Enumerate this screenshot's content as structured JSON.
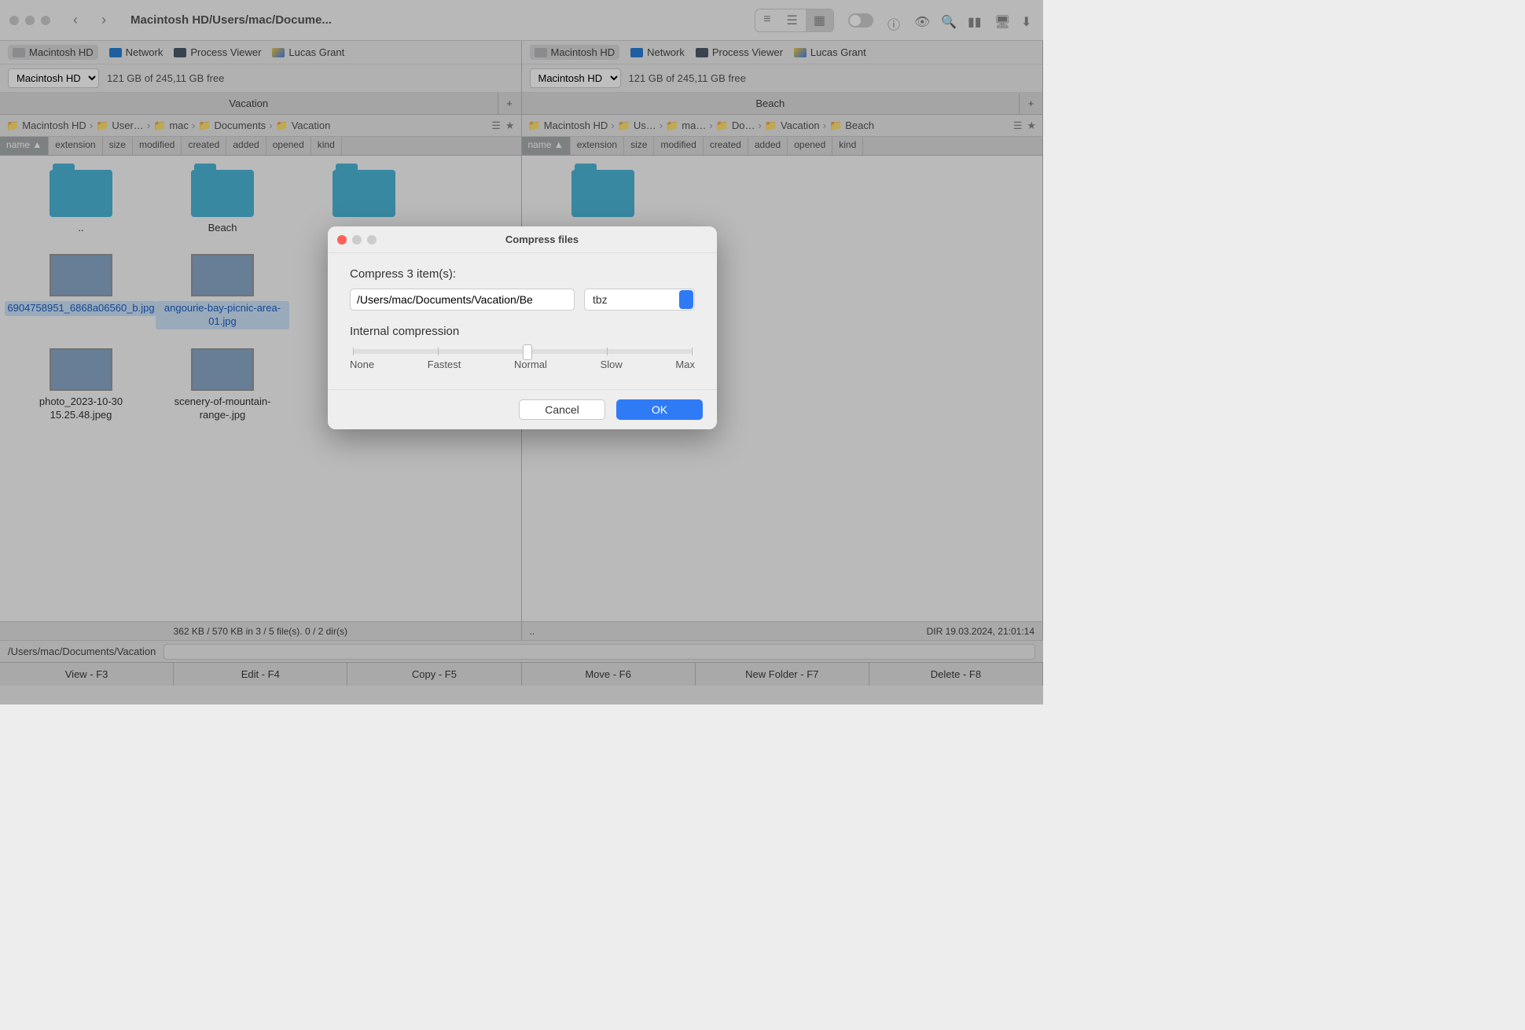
{
  "window": {
    "title": "Macintosh HD/Users/mac/Docume..."
  },
  "favbar": [
    {
      "label": "Macintosh HD",
      "sel": true,
      "icon": "hd"
    },
    {
      "label": "Network",
      "icon": "net"
    },
    {
      "label": "Process Viewer",
      "icon": "mon"
    },
    {
      "label": "Lucas Grant",
      "icon": "gd"
    }
  ],
  "left": {
    "volume": "Macintosh HD",
    "free": "121 GB of 245,11 GB free",
    "tab": "Vacation",
    "crumbs": [
      "Macintosh HD",
      "User…",
      "mac",
      "Documents",
      "Vacation"
    ],
    "cols": [
      "name",
      "extension",
      "size",
      "modified",
      "created",
      "added",
      "opened",
      "kind"
    ],
    "items": [
      {
        "label": "..",
        "type": "folder"
      },
      {
        "label": "Beach",
        "type": "folder"
      },
      {
        "label": "",
        "type": "folder"
      },
      {
        "label": "6904758951_6868a06560_b.jpg",
        "type": "img",
        "sel": true
      },
      {
        "label": "angourie-bay-picnic-area-01.jpg",
        "type": "img",
        "sel": true
      },
      {
        "label": "",
        "type": "img",
        "sel": true
      },
      {
        "label": "photo_2023-10-30 15.25.48.jpeg",
        "type": "img"
      },
      {
        "label": "scenery-of-mountain-range-.jpg",
        "type": "img"
      }
    ],
    "status": "362 KB / 570 KB in 3 / 5 file(s). 0 / 2 dir(s)"
  },
  "right": {
    "volume": "Macintosh HD",
    "free": "121 GB of 245,11 GB free",
    "tab": "Beach",
    "crumbs": [
      "Macintosh HD",
      "Us…",
      "ma…",
      "Do…",
      "Vacation",
      "Beach"
    ],
    "cols": [
      "name",
      "extension",
      "size",
      "modified",
      "created",
      "added",
      "opened",
      "kind"
    ],
    "items": [
      {
        "label": "",
        "type": "folder"
      }
    ],
    "status_l": "..",
    "status_r": "DIR   19.03.2024, 21:01:14"
  },
  "path": "/Users/mac/Documents/Vacation",
  "fkeys": [
    "View - F3",
    "Edit - F4",
    "Copy - F5",
    "Move - F6",
    "New Folder - F7",
    "Delete - F8"
  ],
  "modal": {
    "title": "Compress files",
    "subtitle": "Compress 3 item(s):",
    "dest": "/Users/mac/Documents/Vacation/Be",
    "format": "tbz",
    "section": "Internal compression",
    "slider_labels": [
      "None",
      "Fastest",
      "Normal",
      "Slow",
      "Max"
    ],
    "cancel": "Cancel",
    "ok": "OK"
  }
}
